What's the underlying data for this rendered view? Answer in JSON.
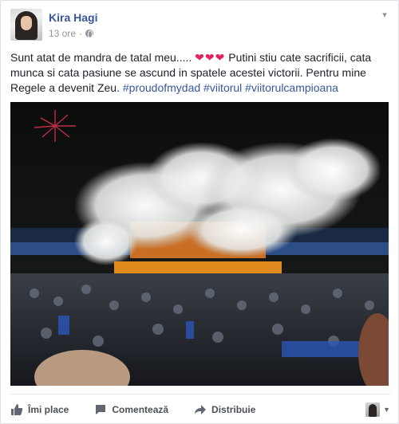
{
  "post": {
    "author": "Kira Hagi",
    "time": "13 ore",
    "separator": "·",
    "privacy_icon": "globe-icon",
    "menu_icon": "chevron-down-icon",
    "text": "Sunt atat de mandra de tatal meu..... ",
    "hearts": "❤❤❤",
    "text_cont": " Putini stiu cate sacrificii, cata munca si cata pasiune se ascund in spatele acestei victorii. Pentru mine Regele a devenit Zeu. ",
    "hashtags": "#proudofmydad #viitorul #viitorulcampioana",
    "link_color": "#365899",
    "heart_color": "#e0245e"
  },
  "actions": {
    "like": "Îmi place",
    "comment": "Comentează",
    "share": "Distribuie"
  }
}
